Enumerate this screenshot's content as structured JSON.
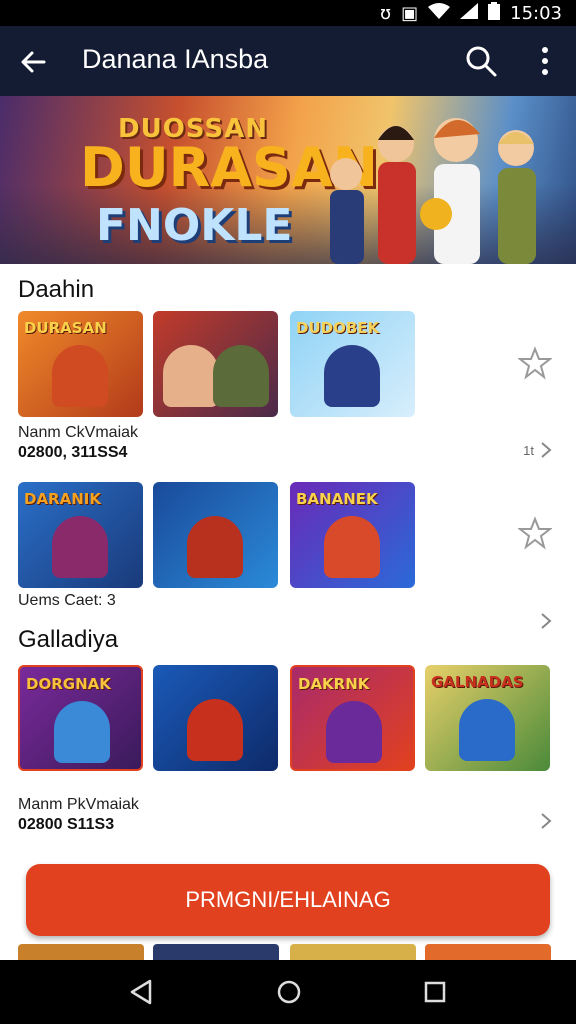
{
  "status": {
    "time": "15:03",
    "icons": [
      "n-icon",
      "notification-icon",
      "wifi-icon",
      "signal-icon",
      "battery-icon"
    ]
  },
  "app_bar": {
    "title": "Danana IAnsba"
  },
  "hero": {
    "line1": "DUOSSAN",
    "line2": "DURASAN",
    "line3": "FNOKLE"
  },
  "section1": {
    "title": "Daahin",
    "row1": {
      "tiles": [
        "DURASAN",
        "",
        "DUDOBEK"
      ],
      "meta_line1": "Nanm CkVmaiak",
      "meta_line2": "02800, 311SS4",
      "tag": "1t"
    },
    "row2": {
      "tiles": [
        "DARANIK",
        "",
        "BANANEK"
      ],
      "meta_line1": "Uems Caet: 3"
    }
  },
  "section2": {
    "title": "Galladiya",
    "tiles": [
      "DORGNAK",
      "",
      "DAKRNK",
      "GALNADAS"
    ],
    "meta_line1": "Manm PkVmaiak",
    "meta_line2": "02800 S11S3"
  },
  "cta": {
    "label": "PRMGNI/EHLAINAG"
  },
  "colors": {
    "app_bar": "#141c33",
    "cta": "#e2411f",
    "accent_gold": "#f8b21e"
  }
}
